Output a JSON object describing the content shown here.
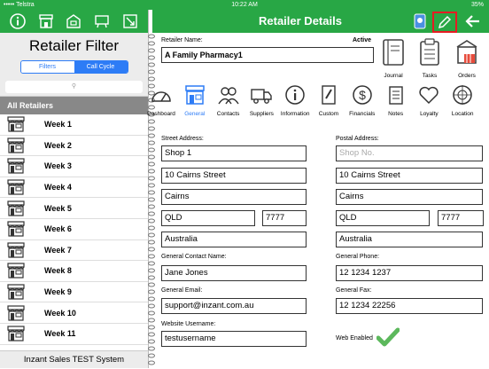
{
  "status": {
    "carrier": "••••• Telstra",
    "time": "10:22 AM",
    "battery": "35%"
  },
  "left": {
    "title": "Retailer Filter",
    "segments": [
      "Filters",
      "Call Cycle"
    ],
    "all_label": "All Retailers",
    "weeks": [
      "Week 1",
      "Week 2",
      "Week 3",
      "Week 4",
      "Week 5",
      "Week 6",
      "Week 7",
      "Week 8",
      "Week 9",
      "Week 10",
      "Week 11"
    ],
    "footer": "Inzant Sales TEST System"
  },
  "right": {
    "title": "Retailer Details",
    "retailer_name_label": "Retailer Name:",
    "active_label": "Active",
    "retailer_name": "A Family Pharmacy1",
    "actions": [
      "Journal",
      "Tasks",
      "Orders"
    ],
    "tabs": [
      "Dashboard",
      "General",
      "Contacts",
      "Suppliers",
      "Information",
      "Custom",
      "Financials",
      "Notes",
      "Loyalty",
      "Location"
    ],
    "street_label": "Street Address:",
    "postal_label": "Postal Address:",
    "street": {
      "line1": "Shop 1",
      "line2": "10 Cairns Street",
      "city": "Cairns",
      "state": "QLD",
      "postcode": "7777",
      "country": "Australia"
    },
    "postal": {
      "line1_placeholder": "Shop No.",
      "line2": "10 Cairns Street",
      "city": "Cairns",
      "state": "QLD",
      "postcode": "7777",
      "country": "Australia"
    },
    "contact_label": "General Contact Name:",
    "contact": "Jane Jones",
    "phone_label": "General Phone:",
    "phone": "12 1234 1237",
    "email_label": "General Email:",
    "email": "support@inzant.com.au",
    "fax_label": "General Fax:",
    "fax": "12 1234 22256",
    "web_label": "Website Username:",
    "web": "testusername",
    "web_enabled_label": "Web Enabled"
  },
  "colors": {
    "green": "#28a745",
    "blue": "#2d7cf6",
    "highlight": "#e51c23"
  }
}
